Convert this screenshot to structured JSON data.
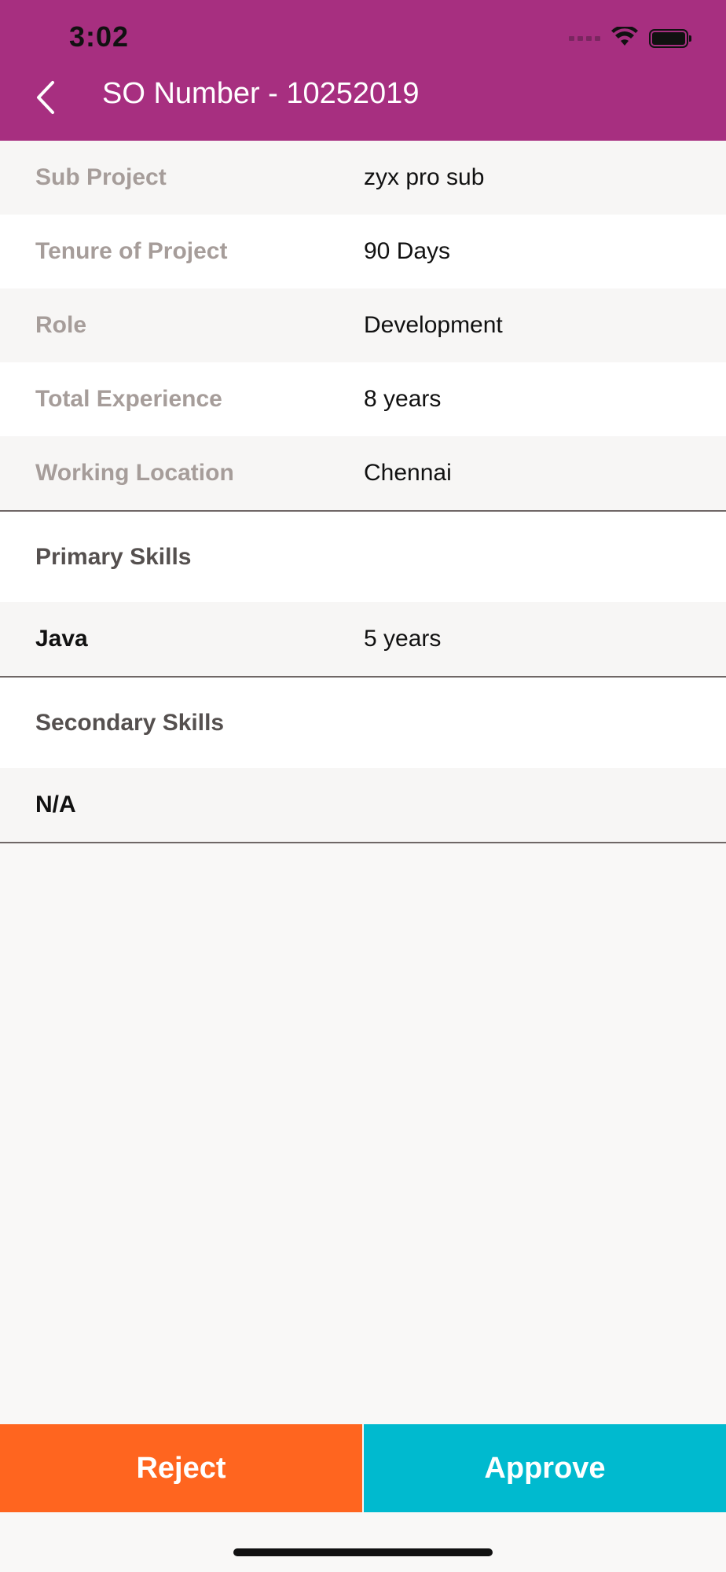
{
  "status_bar": {
    "time": "3:02"
  },
  "header": {
    "title": "SO Number - 10252019",
    "back_icon": "chevron-left-icon"
  },
  "details": [
    {
      "label": "Sub Project",
      "value": "zyx pro sub"
    },
    {
      "label": "Tenure of Project",
      "value": "90 Days"
    },
    {
      "label": "Role",
      "value": "Development"
    },
    {
      "label": "Total Experience",
      "value": "8 years"
    },
    {
      "label": "Working Location",
      "value": "Chennai"
    }
  ],
  "primary_skills": {
    "title": "Primary Skills",
    "items": [
      {
        "skill": "Java",
        "experience": "5 years"
      }
    ]
  },
  "secondary_skills": {
    "title": "Secondary Skills",
    "items": [
      {
        "skill": "N/A",
        "experience": ""
      }
    ]
  },
  "actions": {
    "reject_label": "Reject",
    "approve_label": "Approve"
  },
  "colors": {
    "header_bg": "#a72f80",
    "reject_bg": "#ff651f",
    "approve_bg": "#00bacf",
    "label_text": "#a69d9a"
  }
}
